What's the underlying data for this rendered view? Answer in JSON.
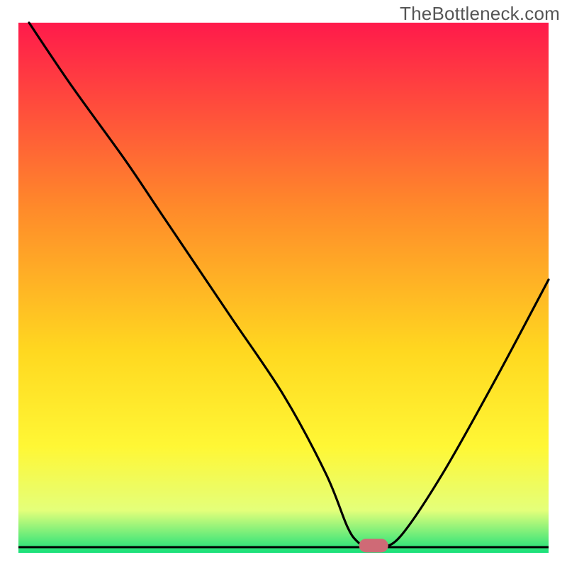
{
  "watermark": {
    "text": "TheBottleneck.com"
  },
  "colors": {
    "grad_top": "#ff1a4b",
    "grad_mid1": "#ff8a2a",
    "grad_mid2": "#ffd820",
    "grad_mid3": "#fff735",
    "grad_mid4": "#e4ff7a",
    "grad_bottom": "#18e07a",
    "curve": "#000000",
    "marker": "#cf6a76"
  },
  "chart_data": {
    "type": "line",
    "title": "",
    "xlabel": "",
    "ylabel": "",
    "xlim": [
      0,
      100
    ],
    "ylim": [
      0,
      100
    ],
    "grid": false,
    "legend": false,
    "x": [
      2,
      10,
      20,
      26,
      30,
      40,
      50,
      58,
      62,
      64,
      66,
      68,
      72,
      80,
      90,
      100
    ],
    "values": [
      100,
      88,
      74,
      65,
      59,
      44,
      29,
      14,
      4,
      1,
      0,
      0,
      2,
      14,
      32,
      51
    ],
    "optimum_x": 67,
    "annotations": []
  }
}
